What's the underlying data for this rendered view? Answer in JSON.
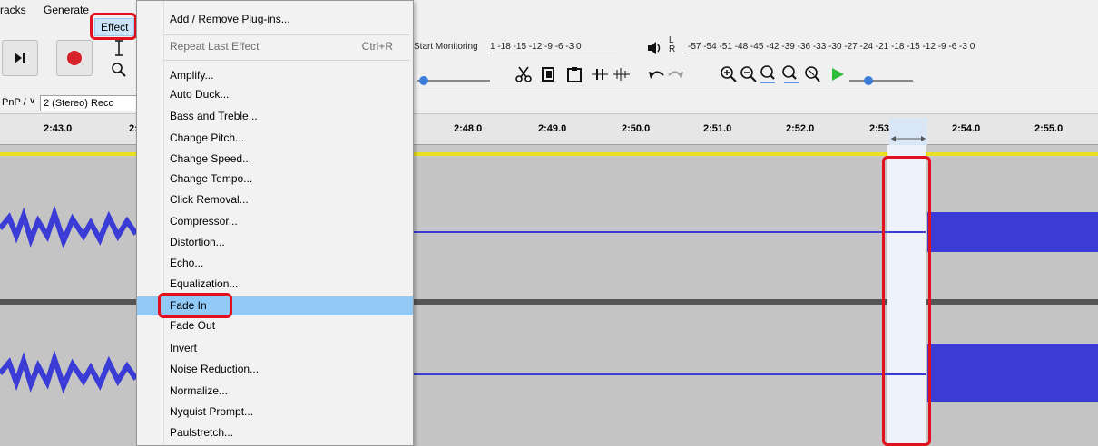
{
  "menubar": {
    "tracks_label": "racks",
    "generate_label": "Generate",
    "effect_label": "Effect"
  },
  "toolbar": {
    "monitoring_text": "Start Monitoring",
    "record_meter_scale": "1 -18 -15 -12 -9 -6 -3 0",
    "playback_lr": "L\nR",
    "playback_meter_scale": "-57 -54 -51 -48 -45 -42 -39 -36 -33 -30 -27 -24 -21 -18 -15 -12 -9 -6 -3 0"
  },
  "device_row": {
    "host_label": "PnP /",
    "channels_label": "2 (Stereo) Reco"
  },
  "ruler": {
    "labels": [
      "2:43.0",
      "2:",
      "2:48.0",
      "2:49.0",
      "2:50.0",
      "2:51.0",
      "2:52.0",
      "2:53.0",
      "2:54.0",
      "2:55.0"
    ]
  },
  "effect_menu": {
    "items": [
      {
        "label": "Add / Remove Plug-ins...",
        "shortcut": "",
        "disabled": false,
        "highlight": false
      },
      {
        "label": "Repeat Last Effect",
        "shortcut": "Ctrl+R",
        "disabled": true,
        "highlight": false
      },
      {
        "label": "Amplify...",
        "shortcut": "",
        "disabled": false,
        "highlight": false
      },
      {
        "label": "Auto Duck...",
        "shortcut": "",
        "disabled": false,
        "highlight": false
      },
      {
        "label": "Bass and Treble...",
        "shortcut": "",
        "disabled": false,
        "highlight": false
      },
      {
        "label": "Change Pitch...",
        "shortcut": "",
        "disabled": false,
        "highlight": false
      },
      {
        "label": "Change Speed...",
        "shortcut": "",
        "disabled": false,
        "highlight": false
      },
      {
        "label": "Change Tempo...",
        "shortcut": "",
        "disabled": false,
        "highlight": false
      },
      {
        "label": "Click Removal...",
        "shortcut": "",
        "disabled": false,
        "highlight": false
      },
      {
        "label": "Compressor...",
        "shortcut": "",
        "disabled": false,
        "highlight": false
      },
      {
        "label": "Distortion...",
        "shortcut": "",
        "disabled": false,
        "highlight": false
      },
      {
        "label": "Echo...",
        "shortcut": "",
        "disabled": false,
        "highlight": false
      },
      {
        "label": "Equalization...",
        "shortcut": "",
        "disabled": false,
        "highlight": false
      },
      {
        "label": "Fade In",
        "shortcut": "",
        "disabled": false,
        "highlight": true
      },
      {
        "label": "Fade Out",
        "shortcut": "",
        "disabled": false,
        "highlight": false
      },
      {
        "label": "Invert",
        "shortcut": "",
        "disabled": false,
        "highlight": false
      },
      {
        "label": "Noise Reduction...",
        "shortcut": "",
        "disabled": false,
        "highlight": false
      },
      {
        "label": "Normalize...",
        "shortcut": "",
        "disabled": false,
        "highlight": false
      },
      {
        "label": "Nyquist Prompt...",
        "shortcut": "",
        "disabled": false,
        "highlight": false
      },
      {
        "label": "Paulstretch...",
        "shortcut": "",
        "disabled": false,
        "highlight": false
      }
    ]
  },
  "colors": {
    "waveform": "#3b3bd6",
    "highlight": "#91c9f7",
    "annotation": "#e3101d",
    "selection": "#eef3fb"
  },
  "icons": [
    "skip-end-icon",
    "record-icon",
    "ibeam-tool-icon",
    "zoom-tool-icon",
    "cut-icon",
    "copy-icon",
    "paste-icon",
    "trim-icon",
    "silence-icon",
    "undo-icon",
    "redo-icon",
    "zoom-in-icon",
    "zoom-out-icon",
    "fit-selection-icon",
    "fit-project-icon",
    "zoom-toggle-icon",
    "play-icon",
    "speaker-icon"
  ]
}
